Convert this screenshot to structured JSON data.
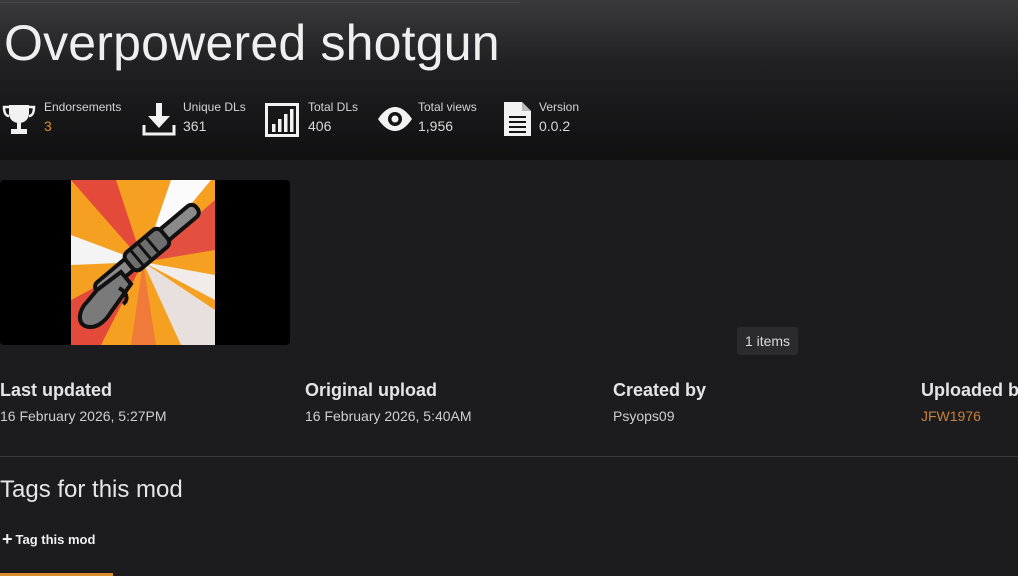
{
  "page": {
    "title": "Overpowered shotgun"
  },
  "stats": [
    {
      "key": "endorsements",
      "label": "Endorsements",
      "value": "3",
      "icon": "trophy-icon"
    },
    {
      "key": "unique_dls",
      "label": "Unique DLs",
      "value": "361",
      "icon": "download-icon"
    },
    {
      "key": "total_dls",
      "label": "Total DLs",
      "value": "406",
      "icon": "bar-chart-icon"
    },
    {
      "key": "total_views",
      "label": "Total views",
      "value": "1,956",
      "icon": "eye-icon"
    },
    {
      "key": "version",
      "label": "Version",
      "value": "0.0.2",
      "icon": "document-icon"
    }
  ],
  "gallery": {
    "items_count": "1 items"
  },
  "meta": {
    "last_updated": {
      "label": "Last updated",
      "value": "16 February 2026, 5:27PM"
    },
    "original_upload": {
      "label": "Original upload",
      "value": "16 February 2026, 5:40AM"
    },
    "created_by": {
      "label": "Created by",
      "value": "Psyops09"
    },
    "uploaded_by": {
      "label": "Uploaded by",
      "value": "JFW1976"
    }
  },
  "tags": {
    "heading": "Tags for this mod",
    "add_label": "Tag this mod"
  },
  "colors": {
    "accent": "#d98e2c",
    "link": "#c7803a",
    "background": "#1c1c1f"
  }
}
